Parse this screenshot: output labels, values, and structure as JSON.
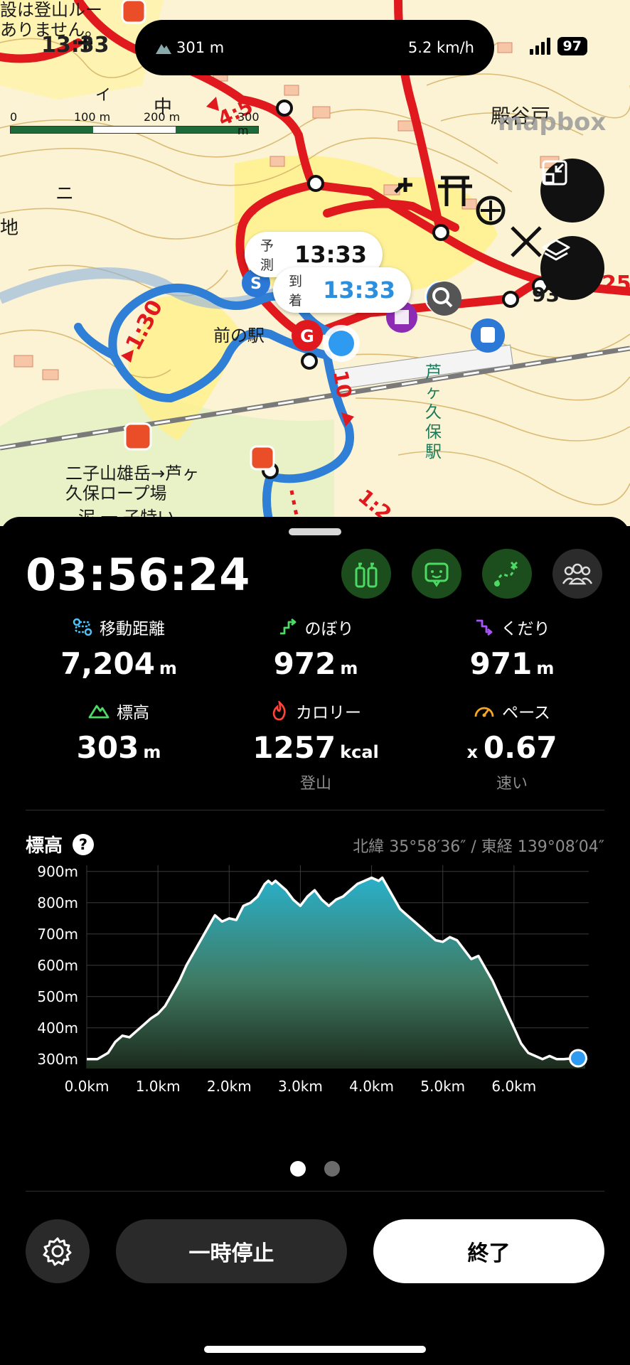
{
  "status": {
    "time": "13:33",
    "elevation": "301 m",
    "speed": "5.2 km/h",
    "battery": "97"
  },
  "map": {
    "notice_line1": "設は登山ルー",
    "notice_line2": "ありません。",
    "brand": "mapbox",
    "place_dentani": "殿谷戸",
    "place_station": "前の駅",
    "station_name": "芦ヶ久保駅",
    "route_label": "二子山雄岳→芦ヶ久保ロープ場",
    "route_label_line2": "ヶ久保ロープ場",
    "route_label_line3": "泥 一 子特い",
    "time_mark_1": "1:30",
    "time_mark_2": "10",
    "time_mark_3": "4:5",
    "time_mark_4": "1:2",
    "time_mark_5": "25",
    "time_mark_6": "93",
    "scale": [
      "0",
      "100 m",
      "200 m",
      "300 m"
    ],
    "kanji_naka": "中",
    "kanji_ni": "ニ",
    "kanji_chi": "地",
    "kanji_i": "イ",
    "bubble_predict_label": "予測",
    "bubble_predict_value": "13:33",
    "bubble_arrive_label": "到着",
    "bubble_arrive_value": "13:33"
  },
  "panel": {
    "elapsed": "03:56:24",
    "stats": [
      {
        "label": "移動距離",
        "value": "7,204",
        "unit": "m",
        "color": "#4fc3f7"
      },
      {
        "label": "のぼり",
        "value": "972",
        "unit": "m",
        "color": "#4cd964"
      },
      {
        "label": "くだり",
        "value": "971",
        "unit": "m",
        "color": "#a855f7"
      },
      {
        "label": "標高",
        "value": "303",
        "unit": "m",
        "color": "#4cd964"
      },
      {
        "label": "カロリー",
        "value": "1257",
        "unit": "kcal",
        "sub": "登山",
        "color": "#ff453a"
      },
      {
        "label": "ペース",
        "prefix": "x",
        "value": "0.67",
        "sub": "速い",
        "color": "#f5a623"
      }
    ],
    "elevation_title": "標高",
    "help": "?",
    "coords": "北緯 35°58′36″ / 東経 139°08′04″",
    "pause_label": "一時停止",
    "end_label": "終了"
  },
  "chart_data": {
    "type": "area",
    "title": "標高",
    "xlabel": "",
    "ylabel": "",
    "x_ticks": [
      "0.0km",
      "1.0km",
      "2.0km",
      "3.0km",
      "4.0km",
      "5.0km",
      "6.0km"
    ],
    "y_ticks": [
      "300m",
      "400m",
      "500m",
      "600m",
      "700m",
      "800m",
      "900m"
    ],
    "xlim": [
      0,
      7.05
    ],
    "ylim": [
      270,
      920
    ],
    "x": [
      0,
      0.15,
      0.3,
      0.4,
      0.5,
      0.6,
      0.7,
      0.8,
      0.9,
      1.0,
      1.1,
      1.2,
      1.3,
      1.4,
      1.5,
      1.6,
      1.7,
      1.8,
      1.9,
      2.0,
      2.1,
      2.2,
      2.3,
      2.4,
      2.5,
      2.55,
      2.6,
      2.65,
      2.7,
      2.8,
      2.9,
      3.0,
      3.1,
      3.2,
      3.3,
      3.4,
      3.5,
      3.6,
      3.7,
      3.8,
      3.9,
      4.0,
      4.1,
      4.15,
      4.2,
      4.3,
      4.4,
      4.5,
      4.6,
      4.7,
      4.8,
      4.9,
      5.0,
      5.1,
      5.2,
      5.3,
      5.4,
      5.5,
      5.6,
      5.7,
      5.8,
      5.9,
      6.0,
      6.1,
      6.2,
      6.3,
      6.4,
      6.5,
      6.6,
      6.7,
      6.8,
      6.9,
      7.0
    ],
    "values": [
      300,
      300,
      320,
      355,
      375,
      370,
      390,
      410,
      430,
      445,
      470,
      510,
      550,
      600,
      640,
      680,
      720,
      760,
      740,
      750,
      745,
      790,
      800,
      820,
      860,
      870,
      860,
      870,
      860,
      840,
      810,
      790,
      820,
      840,
      810,
      790,
      810,
      820,
      840,
      860,
      870,
      880,
      870,
      880,
      860,
      820,
      780,
      760,
      740,
      720,
      700,
      680,
      675,
      690,
      680,
      650,
      620,
      630,
      590,
      550,
      500,
      450,
      400,
      350,
      320,
      310,
      300,
      310,
      300,
      300,
      302,
      303,
      303
    ],
    "current_position": {
      "x": 6.9,
      "y": 303
    }
  }
}
